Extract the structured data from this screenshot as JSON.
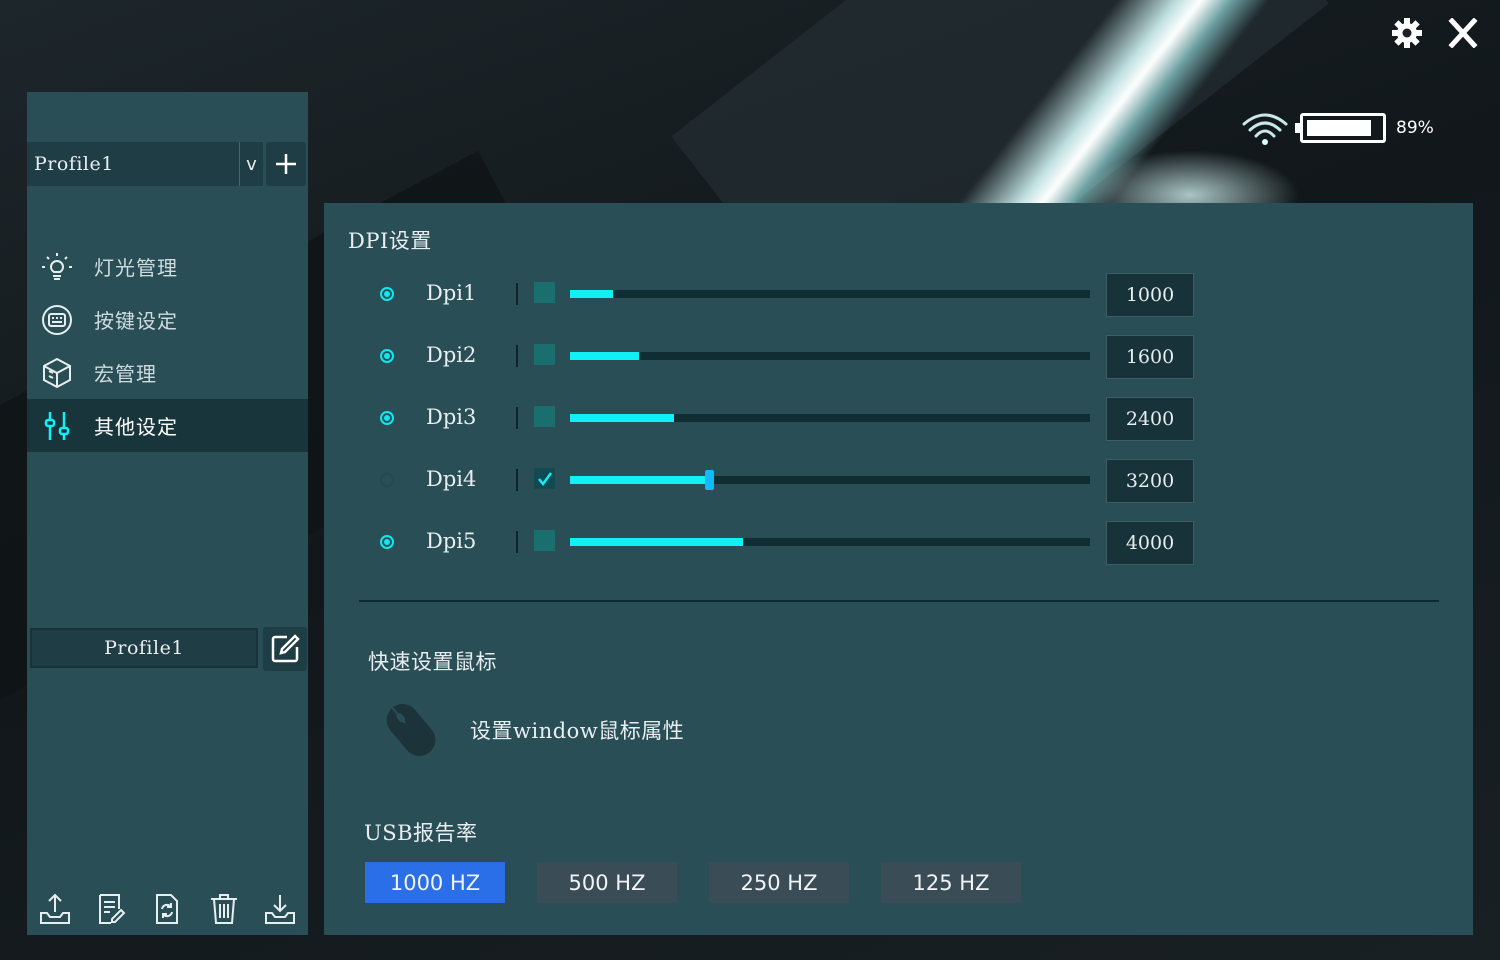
{
  "sidebar": {
    "profile_select": "Profile1",
    "profile_toggle": "v",
    "nav": [
      {
        "label": "灯光管理",
        "icon": "light-icon"
      },
      {
        "label": "按键设定",
        "icon": "keys-icon"
      },
      {
        "label": "宏管理",
        "icon": "macro-cube-icon"
      },
      {
        "label": "其他设定",
        "icon": "sliders-icon",
        "active": true
      }
    ],
    "profile_name": "Profile1",
    "toolbar_icons": [
      "export-icon",
      "notes-icon",
      "refresh-icon",
      "trash-icon",
      "import-icon"
    ]
  },
  "status": {
    "battery_percent": 89,
    "battery_text": "89%"
  },
  "dpi": {
    "title": "DPI设置",
    "max": 12000,
    "rows": [
      {
        "label": "Dpi1",
        "value": "1000",
        "num": 1000,
        "radio": true,
        "checked": false
      },
      {
        "label": "Dpi2",
        "value": "1600",
        "num": 1600,
        "radio": true,
        "checked": false
      },
      {
        "label": "Dpi3",
        "value": "2400",
        "num": 2400,
        "radio": true,
        "checked": false
      },
      {
        "label": "Dpi4",
        "value": "3200",
        "num": 3200,
        "radio": false,
        "checked": true
      },
      {
        "label": "Dpi5",
        "value": "4000",
        "num": 4000,
        "radio": true,
        "checked": false
      }
    ]
  },
  "quick": {
    "title": "快速设置鼠标",
    "link_label": "设置window鼠标属性"
  },
  "usb": {
    "title": "USB报告率",
    "options": [
      {
        "label": "1000 HZ",
        "active": true
      },
      {
        "label": "500 HZ",
        "active": false
      },
      {
        "label": "250 HZ",
        "active": false
      },
      {
        "label": "125 HZ",
        "active": false
      }
    ]
  },
  "colors": {
    "accent": "#10f0f5",
    "active_button": "#2a6ee8",
    "panel": "#2a4e56"
  }
}
